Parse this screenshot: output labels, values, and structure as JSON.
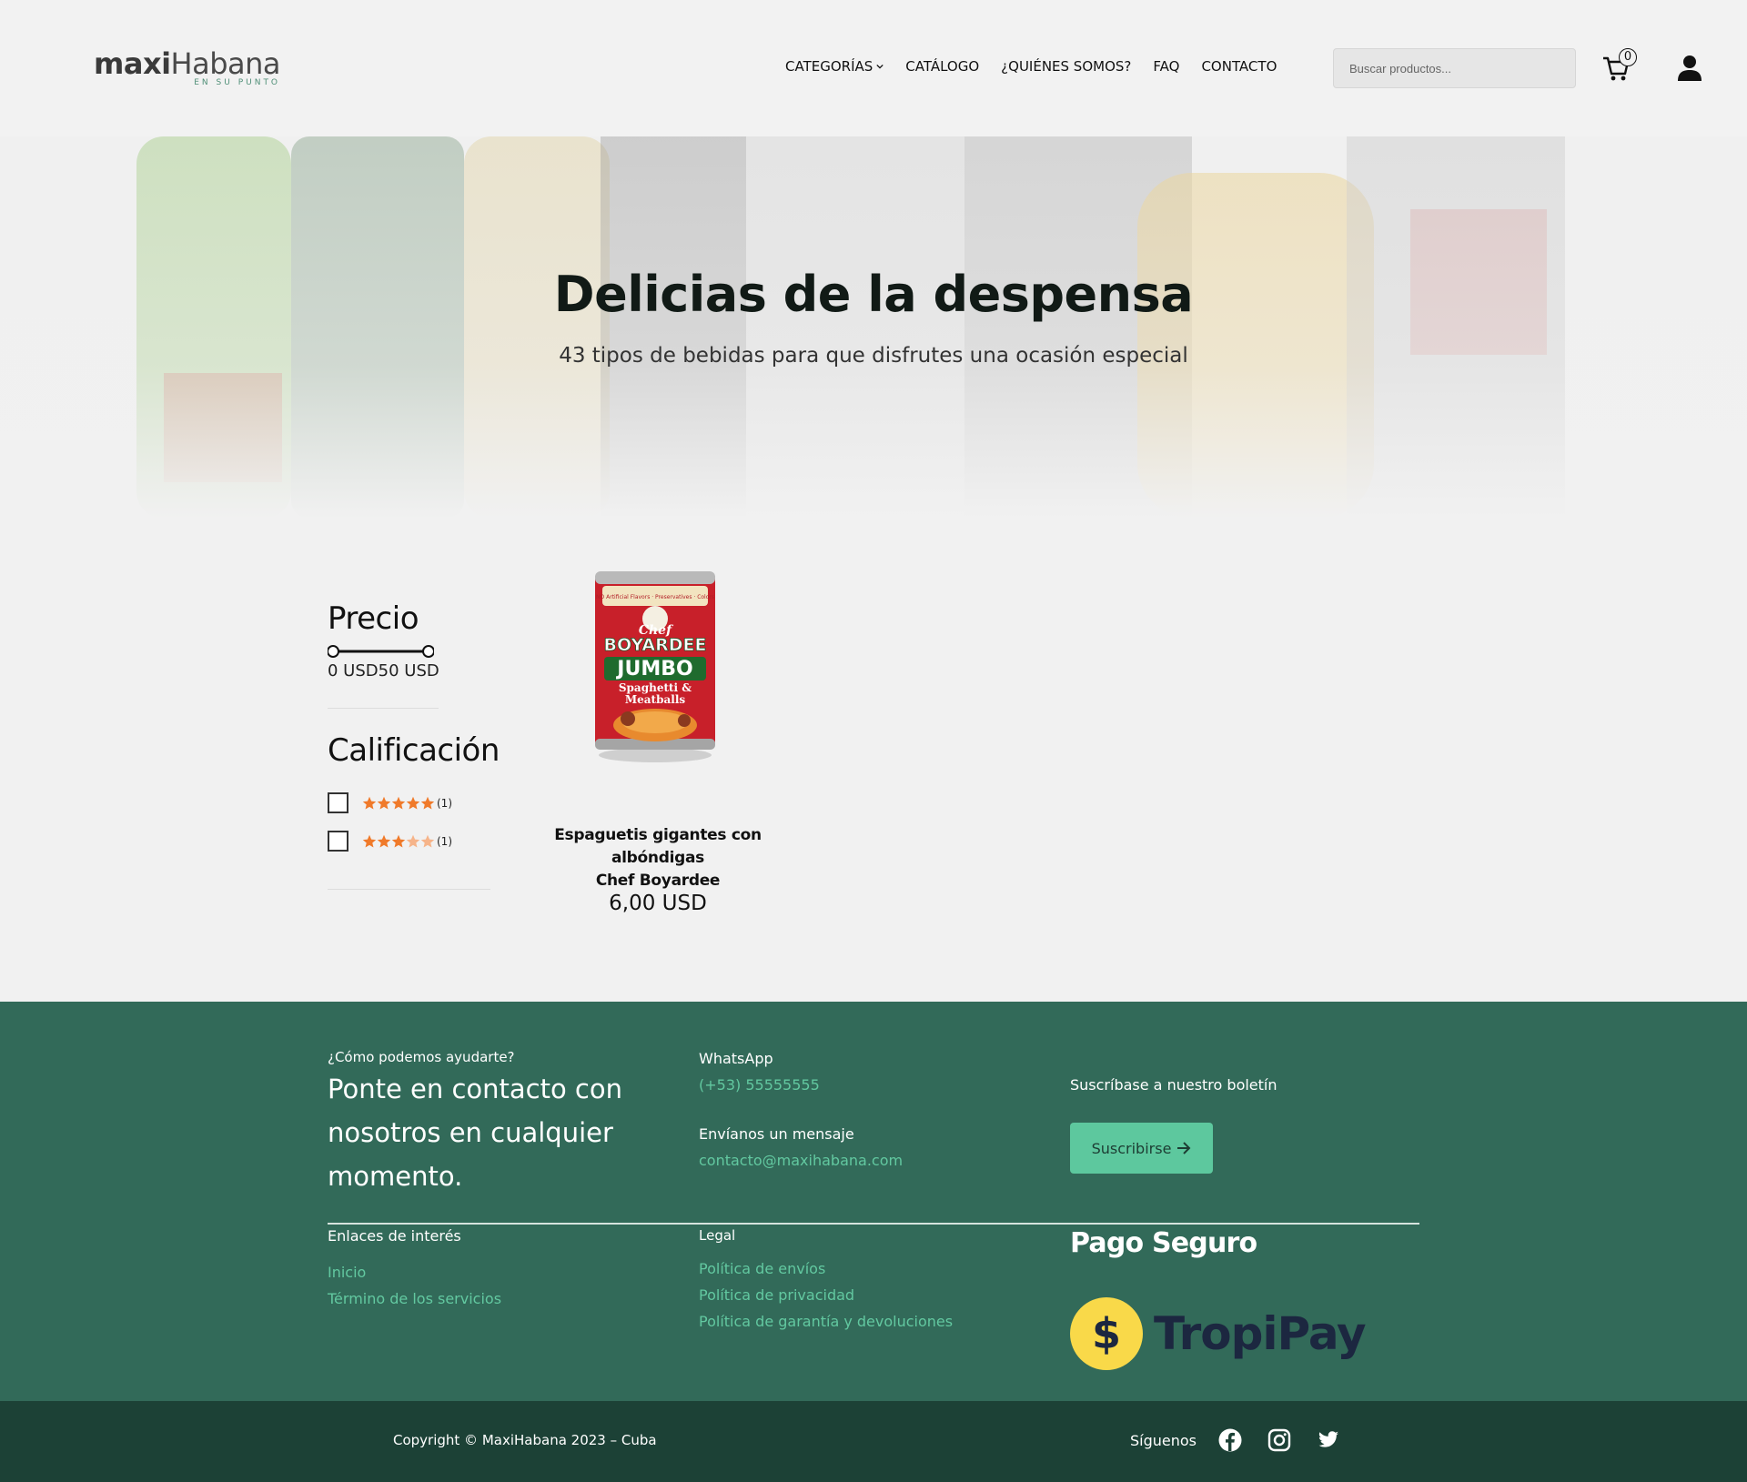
{
  "header": {
    "logo": {
      "maxi": "maxi",
      "habana": "Habana",
      "tagline": "EN SU PUNTO"
    },
    "nav": [
      {
        "label": "CATEGORÍAS",
        "has_dropdown": true
      },
      {
        "label": "CATÁLOGO"
      },
      {
        "label": "¿QUIÉNES SOMOS?"
      },
      {
        "label": "FAQ"
      },
      {
        "label": "CONTACTO"
      }
    ],
    "search": {
      "placeholder": "Buscar productos...",
      "value": ""
    },
    "cart": {
      "count": "0",
      "icon": "cart-icon"
    },
    "user": {
      "icon": "user-icon"
    }
  },
  "hero": {
    "title": "Delicias de la despensa",
    "subtitle": "43 tipos de bebidas para que disfrutes una ocasión especial"
  },
  "filters": {
    "price": {
      "title": "Precio",
      "min_label": "0 USD",
      "max_label": "50 USD",
      "min_value": 0,
      "max_value": 50
    },
    "rating": {
      "title": "Calificación",
      "options": [
        {
          "stars": 5,
          "count": "(1)",
          "checked": false
        },
        {
          "stars": 3,
          "count": "(1)",
          "checked": false
        }
      ]
    }
  },
  "product": {
    "name_line1": "Espaguetis gigantes con albóndigas",
    "name_line2": "Chef Boyardee",
    "price": "6,00 USD",
    "image_label": {
      "brand_top": "Chef",
      "brand": "BOYARDEE",
      "variant": "JUMBO",
      "desc1": "Spaghetti &",
      "desc2": "Meatballs"
    }
  },
  "footer": {
    "help_question": "¿Cómo podemos ayudarte?",
    "help_text": "Ponte en contacto con nosotros en cualquier momento.",
    "whatsapp_label": "WhatsApp",
    "whatsapp_number": "(+53) 55555555",
    "message_label": "Envíanos un mensaje",
    "email": "contacto@maxihabana.com",
    "newsletter_label": "Suscríbase a nuestro boletín",
    "subscribe_button": "Suscribirse",
    "links_title": "Enlaces de interés",
    "links": [
      "Inicio",
      "Término de los servicios"
    ],
    "legal_title": "Legal",
    "legal_links": [
      "Política de envíos",
      "Política de privacidad",
      "Política de garantía y devoluciones"
    ],
    "secure_payment_title": "Pago Seguro",
    "payment_brand": "TropiPay",
    "payment_coin_symbol": "$"
  },
  "bottom_bar": {
    "copyright": "Copyright © MaxiHabana 2023 – Cuba",
    "follow_label": "Síguenos",
    "social_icons": [
      "facebook-icon",
      "instagram-icon",
      "twitter-icon"
    ]
  },
  "colors": {
    "brand_green": "#326a59",
    "dark_green": "#1c4136",
    "accent_mint": "#5dc89e",
    "link_mint": "#62c8a0",
    "star_orange": "#f07a2a",
    "tropipay_yellow": "#f9d949",
    "tropipay_navy": "#1c2740"
  }
}
